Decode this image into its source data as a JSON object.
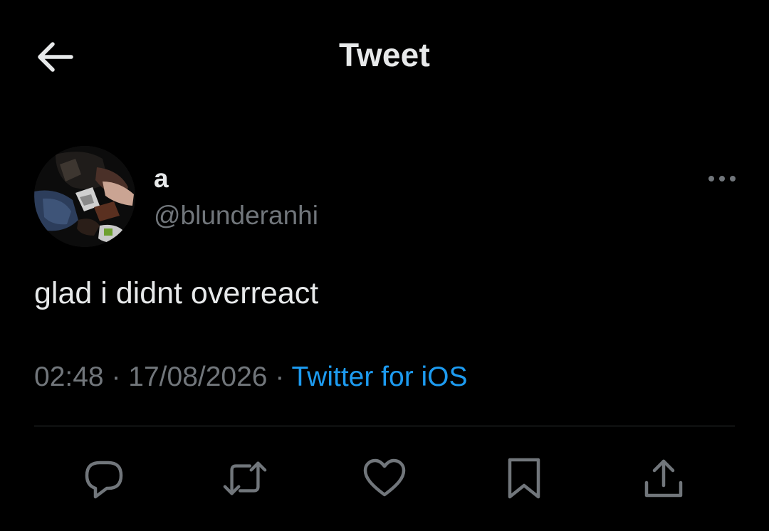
{
  "header": {
    "title": "Tweet",
    "back_icon": "arrow-left-icon"
  },
  "tweet": {
    "author": {
      "display_name": "a",
      "handle": "@blunderanhi",
      "avatar_icon": "avatar-photo"
    },
    "text": "glad i didnt overreact",
    "time": "02:48",
    "date": "17/08/2026",
    "separator": "·",
    "source": "Twitter for iOS",
    "more_icon": "more-horizontal-icon"
  },
  "actions": [
    {
      "icon": "reply-icon"
    },
    {
      "icon": "retweet-icon"
    },
    {
      "icon": "like-icon"
    },
    {
      "icon": "bookmark-icon"
    },
    {
      "icon": "share-icon"
    }
  ],
  "colors": {
    "background": "#000000",
    "text": "#e7e9ea",
    "secondary": "#71767b",
    "accent": "#1d9bf0",
    "divider": "#2f3336"
  }
}
